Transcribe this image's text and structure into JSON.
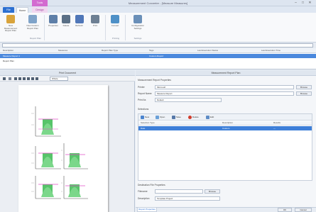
{
  "window": {
    "title": "Measurement Converter - [Measure Measures]",
    "context_tab": "Tools",
    "minimize_glyph": "–",
    "maximize_glyph": "□",
    "close_glyph": "✕"
  },
  "tabs": [
    {
      "label": "File"
    },
    {
      "label": "Home"
    },
    {
      "label": "Design"
    }
  ],
  "ribbon": {
    "buttons": [
      {
        "label": "New Measurement Report Plan",
        "icon": "new-report-icon",
        "color": "#d9a33b"
      },
      {
        "label": "New Custom Report Plan",
        "icon": "custom-report-icon",
        "color": "#7fa3c9"
      },
      {
        "label": "Properties",
        "icon": "properties-icon",
        "color": "#5e7fa8"
      },
      {
        "label": "Delete",
        "icon": "delete-icon",
        "color": "#5a6f86"
      },
      {
        "label": "Refresh",
        "icon": "refresh-icon",
        "color": "#5077b8"
      },
      {
        "label": "Print",
        "icon": "print-icon",
        "color": "#6d7f93"
      },
      {
        "label": "Convert",
        "icon": "convert-icon",
        "color": "#4e90c7"
      },
      {
        "label": "Configuration Settings",
        "icon": "settings-icon",
        "color": "#6a8fb8"
      }
    ],
    "groups": [
      {
        "label": "Report Plan"
      },
      {
        "label": "Printing"
      },
      {
        "label": "Settings"
      }
    ]
  },
  "grid": {
    "columns": [
      "Description",
      "Measures",
      "Report Plan Type",
      "Tags",
      "Last Execution Status",
      "Last Execution Time"
    ],
    "rows": [
      {
        "cells": [
          "Measure Report 1",
          "",
          "",
          "Custom Report",
          "",
          ""
        ]
      },
      {
        "cells": [
          "Report Plan",
          "",
          "",
          "",
          "",
          ""
        ]
      }
    ]
  },
  "left_panel": {
    "title": "Print Document",
    "zoom": "Whole"
  },
  "right_panel": {
    "title": "Measurement Report Plan",
    "section_report_properties": "Measurement Report Properties",
    "fields": [
      {
        "label": "Printer",
        "value": "Microsoft",
        "button": "Browse"
      },
      {
        "label": "Report Name",
        "value": "Measure Report",
        "button": "Browse"
      },
      {
        "label": "Print As",
        "value": "Default",
        "button": ""
      }
    ],
    "selections_label": "Selections",
    "toolbar": [
      {
        "label": "New",
        "icon": "new-icon",
        "color": "#4a84cf"
      },
      {
        "label": "Open",
        "icon": "open-icon",
        "color": "#6aa0d8"
      },
      {
        "label": "Save",
        "icon": "save-icon",
        "color": "#5578a8"
      },
      {
        "label": "Delete",
        "icon": "delete-icon",
        "color": "#d13b2b"
      },
      {
        "label": "Edit",
        "icon": "edit-icon",
        "color": "#5e8cc6"
      }
    ],
    "sel_columns": [
      "Selection Type",
      "Description",
      "Results"
    ],
    "sel_rows": [
      {
        "cells": [
          "Date",
          "Custom",
          "—"
        ]
      }
    ],
    "output_section": "Destination File Properties",
    "output_fields": [
      {
        "label": "Filename",
        "value": "",
        "button": "Browse"
      },
      {
        "label": "Description",
        "value": "Template Project",
        "button": ""
      }
    ],
    "footer_tab": "Report Properties",
    "ok_label": "OK",
    "cancel_label": "Cancel"
  }
}
